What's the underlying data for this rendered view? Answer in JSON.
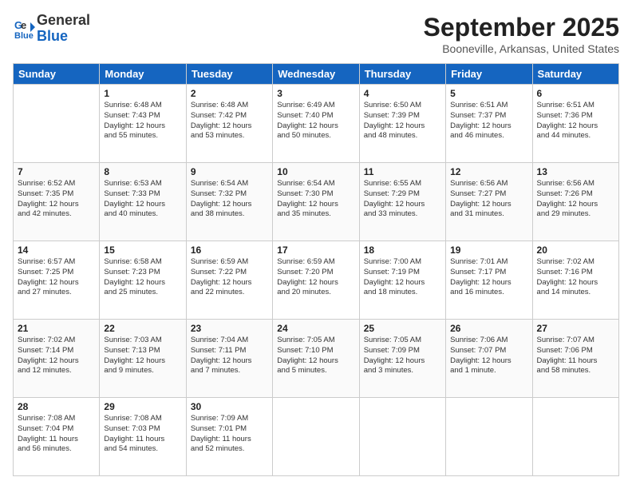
{
  "logo": {
    "line1": "General",
    "line2": "Blue"
  },
  "title": "September 2025",
  "location": "Booneville, Arkansas, United States",
  "headers": [
    "Sunday",
    "Monday",
    "Tuesday",
    "Wednesday",
    "Thursday",
    "Friday",
    "Saturday"
  ],
  "weeks": [
    [
      {
        "day": "",
        "info": ""
      },
      {
        "day": "1",
        "info": "Sunrise: 6:48 AM\nSunset: 7:43 PM\nDaylight: 12 hours\nand 55 minutes."
      },
      {
        "day": "2",
        "info": "Sunrise: 6:48 AM\nSunset: 7:42 PM\nDaylight: 12 hours\nand 53 minutes."
      },
      {
        "day": "3",
        "info": "Sunrise: 6:49 AM\nSunset: 7:40 PM\nDaylight: 12 hours\nand 50 minutes."
      },
      {
        "day": "4",
        "info": "Sunrise: 6:50 AM\nSunset: 7:39 PM\nDaylight: 12 hours\nand 48 minutes."
      },
      {
        "day": "5",
        "info": "Sunrise: 6:51 AM\nSunset: 7:37 PM\nDaylight: 12 hours\nand 46 minutes."
      },
      {
        "day": "6",
        "info": "Sunrise: 6:51 AM\nSunset: 7:36 PM\nDaylight: 12 hours\nand 44 minutes."
      }
    ],
    [
      {
        "day": "7",
        "info": "Sunrise: 6:52 AM\nSunset: 7:35 PM\nDaylight: 12 hours\nand 42 minutes."
      },
      {
        "day": "8",
        "info": "Sunrise: 6:53 AM\nSunset: 7:33 PM\nDaylight: 12 hours\nand 40 minutes."
      },
      {
        "day": "9",
        "info": "Sunrise: 6:54 AM\nSunset: 7:32 PM\nDaylight: 12 hours\nand 38 minutes."
      },
      {
        "day": "10",
        "info": "Sunrise: 6:54 AM\nSunset: 7:30 PM\nDaylight: 12 hours\nand 35 minutes."
      },
      {
        "day": "11",
        "info": "Sunrise: 6:55 AM\nSunset: 7:29 PM\nDaylight: 12 hours\nand 33 minutes."
      },
      {
        "day": "12",
        "info": "Sunrise: 6:56 AM\nSunset: 7:27 PM\nDaylight: 12 hours\nand 31 minutes."
      },
      {
        "day": "13",
        "info": "Sunrise: 6:56 AM\nSunset: 7:26 PM\nDaylight: 12 hours\nand 29 minutes."
      }
    ],
    [
      {
        "day": "14",
        "info": "Sunrise: 6:57 AM\nSunset: 7:25 PM\nDaylight: 12 hours\nand 27 minutes."
      },
      {
        "day": "15",
        "info": "Sunrise: 6:58 AM\nSunset: 7:23 PM\nDaylight: 12 hours\nand 25 minutes."
      },
      {
        "day": "16",
        "info": "Sunrise: 6:59 AM\nSunset: 7:22 PM\nDaylight: 12 hours\nand 22 minutes."
      },
      {
        "day": "17",
        "info": "Sunrise: 6:59 AM\nSunset: 7:20 PM\nDaylight: 12 hours\nand 20 minutes."
      },
      {
        "day": "18",
        "info": "Sunrise: 7:00 AM\nSunset: 7:19 PM\nDaylight: 12 hours\nand 18 minutes."
      },
      {
        "day": "19",
        "info": "Sunrise: 7:01 AM\nSunset: 7:17 PM\nDaylight: 12 hours\nand 16 minutes."
      },
      {
        "day": "20",
        "info": "Sunrise: 7:02 AM\nSunset: 7:16 PM\nDaylight: 12 hours\nand 14 minutes."
      }
    ],
    [
      {
        "day": "21",
        "info": "Sunrise: 7:02 AM\nSunset: 7:14 PM\nDaylight: 12 hours\nand 12 minutes."
      },
      {
        "day": "22",
        "info": "Sunrise: 7:03 AM\nSunset: 7:13 PM\nDaylight: 12 hours\nand 9 minutes."
      },
      {
        "day": "23",
        "info": "Sunrise: 7:04 AM\nSunset: 7:11 PM\nDaylight: 12 hours\nand 7 minutes."
      },
      {
        "day": "24",
        "info": "Sunrise: 7:05 AM\nSunset: 7:10 PM\nDaylight: 12 hours\nand 5 minutes."
      },
      {
        "day": "25",
        "info": "Sunrise: 7:05 AM\nSunset: 7:09 PM\nDaylight: 12 hours\nand 3 minutes."
      },
      {
        "day": "26",
        "info": "Sunrise: 7:06 AM\nSunset: 7:07 PM\nDaylight: 12 hours\nand 1 minute."
      },
      {
        "day": "27",
        "info": "Sunrise: 7:07 AM\nSunset: 7:06 PM\nDaylight: 11 hours\nand 58 minutes."
      }
    ],
    [
      {
        "day": "28",
        "info": "Sunrise: 7:08 AM\nSunset: 7:04 PM\nDaylight: 11 hours\nand 56 minutes."
      },
      {
        "day": "29",
        "info": "Sunrise: 7:08 AM\nSunset: 7:03 PM\nDaylight: 11 hours\nand 54 minutes."
      },
      {
        "day": "30",
        "info": "Sunrise: 7:09 AM\nSunset: 7:01 PM\nDaylight: 11 hours\nand 52 minutes."
      },
      {
        "day": "",
        "info": ""
      },
      {
        "day": "",
        "info": ""
      },
      {
        "day": "",
        "info": ""
      },
      {
        "day": "",
        "info": ""
      }
    ]
  ]
}
